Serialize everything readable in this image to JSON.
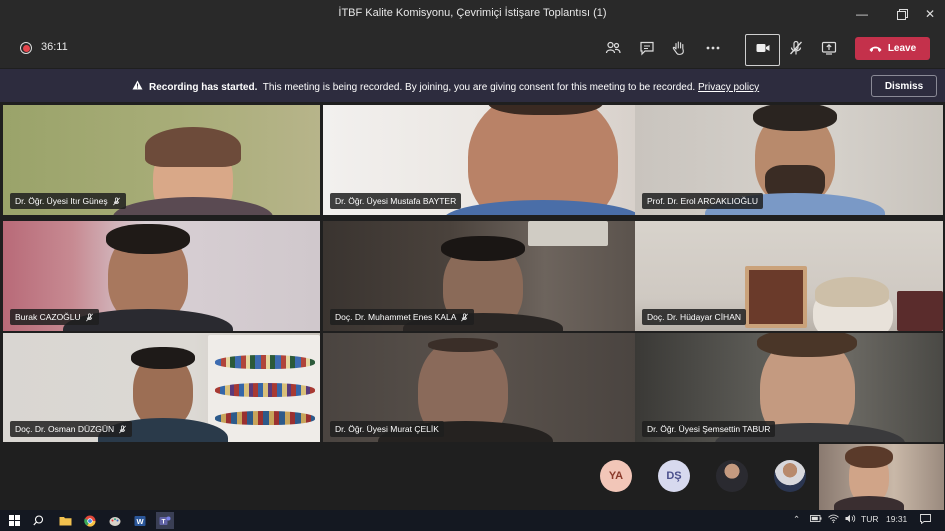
{
  "window": {
    "title": "İTBF Kalite Komisyonu, Çevrimiçi İstişare Toplantısı (1)",
    "minimize_icon": "minimize-icon",
    "maximize_icon": "maximize-icon",
    "close_icon": "close-icon"
  },
  "toolbar": {
    "timer": "36:11",
    "leave_label": "Leave"
  },
  "banner": {
    "heading": "Recording has started.",
    "message": "This meeting is being recorded. By joining, you are giving consent for this meeting to be recorded.",
    "link": "Privacy policy",
    "dismiss_label": "Dismiss"
  },
  "participants": [
    {
      "name": "Dr. Öğr. Üyesi Itır Güneş",
      "muted": true
    },
    {
      "name": "Dr. Öğr. Üyesi Mustafa BAYTER",
      "muted": false
    },
    {
      "name": "Prof. Dr. Erol ARCAKLIOĞLU",
      "muted": false
    },
    {
      "name": "Burak CAZOĞLU",
      "muted": true
    },
    {
      "name": "Doç. Dr. Muhammet Enes KALA",
      "muted": true
    },
    {
      "name": "Doç. Dr. Hüdayar CİHAN",
      "muted": false
    },
    {
      "name": "Doç. Dr. Osman DÜZGÜN",
      "muted": true
    },
    {
      "name": "Dr. Öğr. Üyesi Murat ÇELİK",
      "muted": false
    },
    {
      "name": "Dr. Öğr. Üyesi Şemsettin TABUR",
      "muted": false
    }
  ],
  "overflow_avatars": [
    {
      "initials": "YA",
      "color": "#f2c6b8",
      "text_color": "#8a3a2a"
    },
    {
      "initials": "DŞ",
      "color": "#d7d9ee",
      "text_color": "#4a4f8c"
    }
  ],
  "taskbar": {
    "language": "TUR",
    "time": "19:31"
  },
  "colors": {
    "leave": "#c4314b",
    "banner": "#2d2c3e",
    "recording": "#e5454c"
  }
}
